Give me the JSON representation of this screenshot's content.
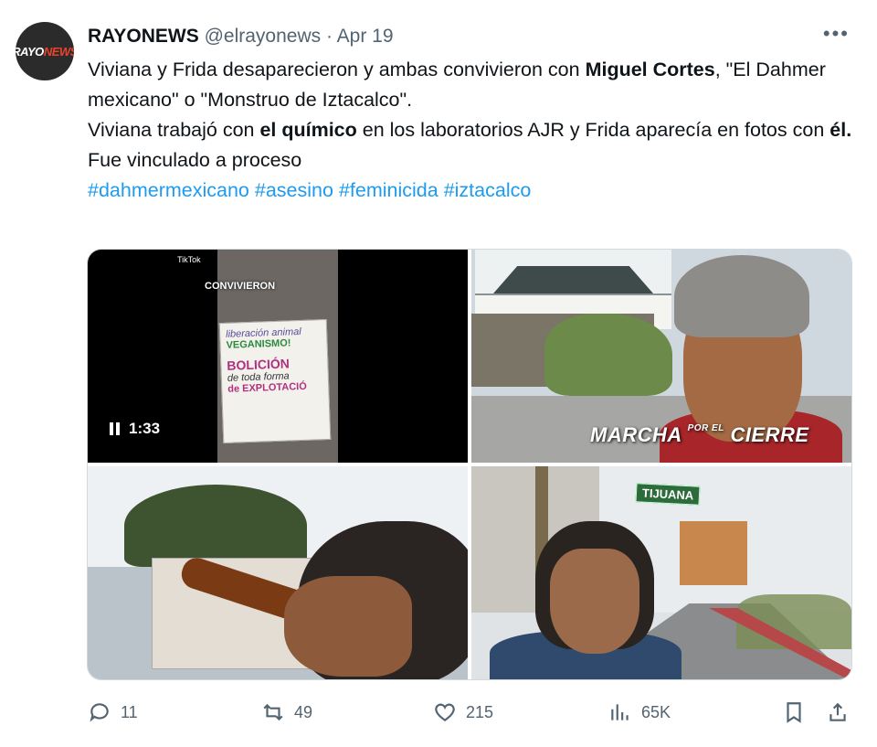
{
  "tweet": {
    "avatar_text_a": "RAYO",
    "avatar_text_b": "NEWS",
    "name": "RAYONEWS",
    "handle": "@elrayonews",
    "separator": "·",
    "date": "Apr 19",
    "more": "•••",
    "lines": [
      {
        "a": "Viviana y Frida desaparecieron y ambas convivieron con ",
        "b": "Miguel Cortes",
        "c": ", \"El Dahmer mexicano\" o \"Monstruo de Iztacalco\"."
      },
      {
        "a": "Viviana trabajó con ",
        "b": "el químico",
        "c": " en los laboratorios AJR y Frida aparecía en fotos con ",
        "d": "él",
        "e": "."
      },
      {
        "a": "Fue vinculado a proceso"
      }
    ],
    "hashtags": [
      "#dahmermexicano",
      "#asesino",
      "#feminicida",
      "#iztacalco"
    ]
  },
  "media": {
    "video": {
      "duration": "1:33",
      "overlay": "CONVIVIERON",
      "tiktok": "TikTok",
      "sign": [
        "liberación animal",
        "VEGANISMO!",
        "BOLICIÓN",
        "de toda forma",
        "de EXPLOTACIÓ"
      ]
    },
    "photo2_caption": "MARCHA",
    "photo2_caption_small": "POR EL",
    "photo2_caption_end": "CIERRE",
    "photo4_sign": "TIJUANA"
  },
  "actions": {
    "replies": "11",
    "reposts": "49",
    "likes": "215",
    "views": "65K"
  }
}
